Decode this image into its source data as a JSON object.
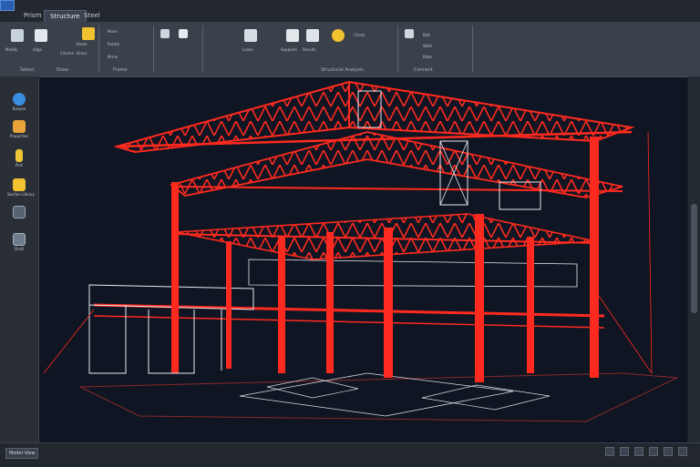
{
  "window": {
    "tabs": [
      "Prism",
      "Structure",
      "Steel"
    ],
    "active_tab": 1
  },
  "ribbon": {
    "groups": [
      {
        "name": "Select",
        "buttons": [
          "Modify",
          "Align"
        ]
      },
      {
        "name": "Draw",
        "buttons": [
          "Beam",
          "Column",
          "Brace"
        ]
      },
      {
        "name": "Frame",
        "buttons": [
          "Move",
          "Rotate",
          "Mirror"
        ]
      },
      {
        "name": "Structural Analysis",
        "buttons": [
          "Loads",
          "Supports",
          "Results",
          "Check"
        ]
      },
      {
        "name": "Connect",
        "buttons": [
          "Bolt",
          "Weld",
          "Plate"
        ]
      }
    ]
  },
  "toolbox": {
    "items": [
      "Browse",
      "Properties",
      "Pick",
      "Section Library",
      "Layers",
      "Draft"
    ]
  },
  "status": {
    "text": "Model View"
  },
  "colors": {
    "structure": "#ff2a1f",
    "wire": "#e8ecf2",
    "background": "#0f1522"
  }
}
